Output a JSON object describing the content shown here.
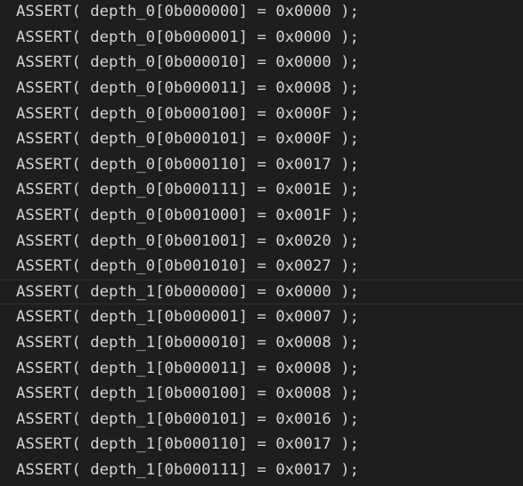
{
  "editor": {
    "lines": [
      "ASSERT( depth_0[0b000000] = 0x0000 );",
      "ASSERT( depth_0[0b000001] = 0x0000 );",
      "ASSERT( depth_0[0b000010] = 0x0000 );",
      "ASSERT( depth_0[0b000011] = 0x0008 );",
      "ASSERT( depth_0[0b000100] = 0x000F );",
      "ASSERT( depth_0[0b000101] = 0x000F );",
      "ASSERT( depth_0[0b000110] = 0x0017 );",
      "ASSERT( depth_0[0b000111] = 0x001E );",
      "ASSERT( depth_0[0b001000] = 0x001F );",
      "ASSERT( depth_0[0b001001] = 0x0020 );",
      "ASSERT( depth_0[0b001010] = 0x0027 );",
      "ASSERT( depth_1[0b000000] = 0x0000 );",
      "ASSERT( depth_1[0b000001] = 0x0007 );",
      "ASSERT( depth_1[0b000010] = 0x0008 );",
      "ASSERT( depth_1[0b000011] = 0x0008 );",
      "ASSERT( depth_1[0b000100] = 0x0008 );",
      "ASSERT( depth_1[0b000101] = 0x0016 );",
      "ASSERT( depth_1[0b000110] = 0x0017 );",
      "ASSERT( depth_1[0b000111] = 0x0017 );"
    ],
    "colors": {
      "background": "#1e1e1e",
      "text": "#d4d4d4",
      "current_line_border": "#2f2f2f"
    }
  }
}
